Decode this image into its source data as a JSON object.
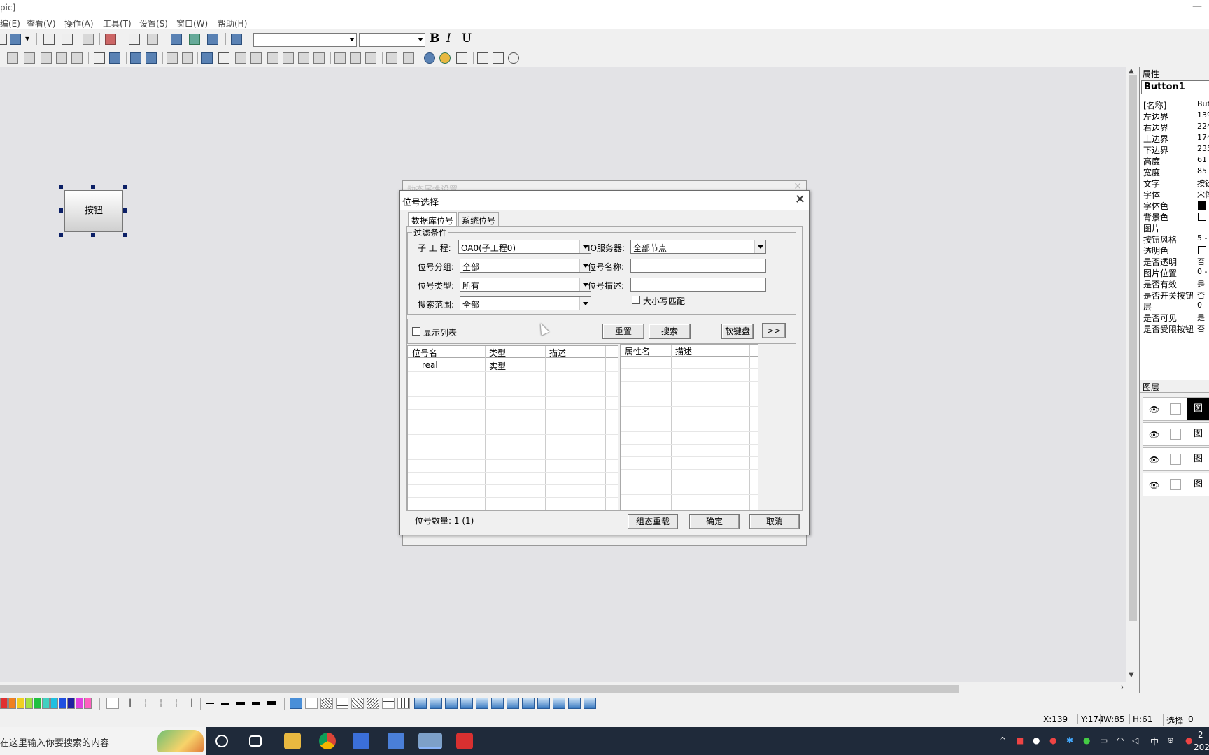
{
  "window": {
    "title": "pic]"
  },
  "menu": [
    "编(E)",
    "查看(V)",
    "操作(A)",
    "工具(T)",
    "设置(S)",
    "窗口(W)",
    "帮助(H)"
  ],
  "format": {
    "bold": "B",
    "italic": "I",
    "underline": "U"
  },
  "canvas": {
    "button_label": "按钮"
  },
  "back_dialog": {
    "title": "动态属性设置"
  },
  "dialog": {
    "title": "位号选择",
    "tabs": [
      "数据库位号",
      "系统位号"
    ],
    "filter": {
      "legend": "过滤条件",
      "subproject_label": "子 工 程:",
      "subproject_value": "OA0(子工程0)",
      "io_server_label": "IO服务器:",
      "io_server_value": "全部节点",
      "group_label": "位号分组:",
      "group_value": "全部",
      "name_label": "位号名称:",
      "name_value": "",
      "type_label": "位号类型:",
      "type_value": "所有",
      "desc_label": "位号描述:",
      "desc_value": "",
      "case_label": "大小写匹配",
      "range_label": "搜索范围:",
      "range_value": "全部"
    },
    "show_list_label": "显示列表",
    "buttons": {
      "reset": "重置",
      "search": "搜索",
      "keyboard": "软键盘",
      "more": ">>",
      "reload": "组态重载",
      "ok": "确定",
      "cancel": "取消"
    },
    "left_table": {
      "headers": [
        "位号名",
        "类型",
        "描述"
      ],
      "rows": [
        {
          "name": "real",
          "type": "实型",
          "desc": ""
        }
      ]
    },
    "right_table": {
      "headers": [
        "属性名",
        "描述"
      ]
    },
    "count_label": "位号数量:",
    "count_value": "1 (1)"
  },
  "props": {
    "header": "属性",
    "object": "Button1",
    "rows": [
      {
        "k": "[名称]",
        "v": "But"
      },
      {
        "k": "左边界",
        "v": "139"
      },
      {
        "k": "右边界",
        "v": "224"
      },
      {
        "k": "上边界",
        "v": "174"
      },
      {
        "k": "下边界",
        "v": "235"
      },
      {
        "k": "高度",
        "v": "61"
      },
      {
        "k": "宽度",
        "v": "85"
      },
      {
        "k": "文字",
        "v": "按钮"
      },
      {
        "k": "字体",
        "v": "宋体"
      },
      {
        "k": "字体色",
        "v": ""
      },
      {
        "k": "背景色",
        "v": ""
      },
      {
        "k": "图片",
        "v": ""
      },
      {
        "k": "按钮风格",
        "v": "5 -"
      },
      {
        "k": "透明色",
        "v": ""
      },
      {
        "k": "是否透明",
        "v": "否"
      },
      {
        "k": "图片位置",
        "v": "0 -"
      },
      {
        "k": "是否有效",
        "v": "是"
      },
      {
        "k": "是否开关按钮",
        "v": "否"
      },
      {
        "k": "层",
        "v": "0"
      },
      {
        "k": "是否可见",
        "v": "是"
      },
      {
        "k": "是否受限按钮",
        "v": "否"
      }
    ]
  },
  "layers": {
    "header": "图层",
    "items": [
      "图",
      "图",
      "图",
      "图"
    ]
  },
  "status": {
    "x": "X:139",
    "y": "Y:174",
    "w": "W:85",
    "h": "H:61",
    "mode": "选择",
    "num": "0"
  },
  "taskbar": {
    "search_placeholder": "在这里输入你要搜索的内容",
    "ime": "中",
    "clock": "2",
    "year": "202"
  }
}
